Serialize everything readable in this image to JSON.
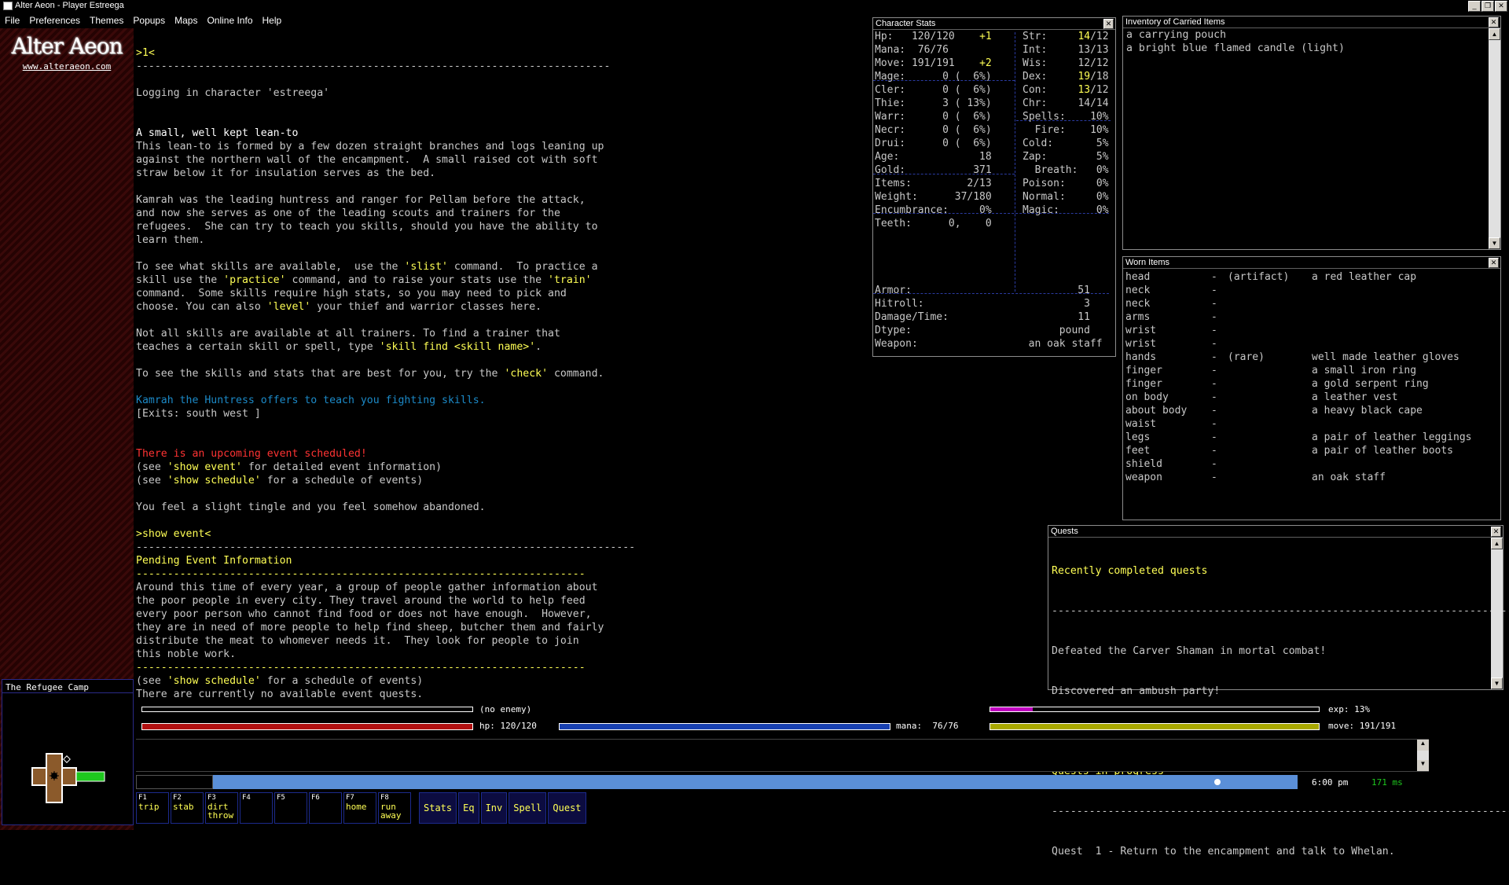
{
  "window": {
    "title": "Alter Aeon - Player Estreega",
    "buttons": [
      "_",
      "❐",
      "✕"
    ]
  },
  "menu": [
    "File",
    "Preferences",
    "Themes",
    "Popups",
    "Maps",
    "Online Info",
    "Help"
  ],
  "logo": {
    "name": "Alter Aeon",
    "url": "www.alteraeon.com"
  },
  "map": {
    "title": "The Refugee Camp"
  },
  "main_lines": [
    [
      {
        "t": ">1<",
        "c": "y"
      }
    ],
    [
      {
        "t": "----------------------------------------------------------------------------"
      }
    ],
    [
      {
        "t": ""
      }
    ],
    [
      {
        "t": "Logging in character 'estreega'"
      }
    ],
    [
      {
        "t": ""
      }
    ],
    [
      {
        "t": ""
      }
    ],
    [
      {
        "t": "A small, well kept lean-to",
        "c": "w"
      }
    ],
    [
      {
        "t": "This lean-to is formed by a few dozen straight branches and logs leaning up"
      }
    ],
    [
      {
        "t": "against the northern wall of the encampment.  A small raised cot with soft"
      }
    ],
    [
      {
        "t": "straw below it for insulation serves as the bed."
      }
    ],
    [
      {
        "t": ""
      }
    ],
    [
      {
        "t": "Kamrah was the leading huntress and ranger for Pellam before the attack,"
      }
    ],
    [
      {
        "t": "and now she serves as one of the leading scouts and trainers for the"
      }
    ],
    [
      {
        "t": "refugees.  She can try to teach you skills, should you have the ability to"
      }
    ],
    [
      {
        "t": "learn them."
      }
    ],
    [
      {
        "t": ""
      }
    ],
    [
      {
        "t": "To see what skills are available,  use the "
      },
      {
        "t": "'slist'",
        "c": "y"
      },
      {
        "t": " command.  To practice a"
      }
    ],
    [
      {
        "t": "skill use the "
      },
      {
        "t": "'practice'",
        "c": "y"
      },
      {
        "t": " command, and to raise your stats use the "
      },
      {
        "t": "'train'",
        "c": "y"
      }
    ],
    [
      {
        "t": "command.  Some skills require high stats, so you may need to pick and"
      }
    ],
    [
      {
        "t": "choose. You can also "
      },
      {
        "t": "'level'",
        "c": "y"
      },
      {
        "t": " your thief and warrior classes here."
      }
    ],
    [
      {
        "t": ""
      }
    ],
    [
      {
        "t": "Not all skills are available at all trainers. To find a trainer that"
      }
    ],
    [
      {
        "t": "teaches a certain skill or spell, type "
      },
      {
        "t": "'skill find <skill name>'",
        "c": "y"
      },
      {
        "t": "."
      }
    ],
    [
      {
        "t": ""
      }
    ],
    [
      {
        "t": "To see the skills and stats that are best for you, try the "
      },
      {
        "t": "'check'",
        "c": "y"
      },
      {
        "t": " command."
      }
    ],
    [
      {
        "t": ""
      }
    ],
    [
      {
        "t": "Kamrah the Huntress offers to teach you fighting skills.",
        "c": "c"
      }
    ],
    [
      {
        "t": "[Exits: south west ]"
      }
    ],
    [
      {
        "t": ""
      }
    ],
    [
      {
        "t": ""
      }
    ],
    [
      {
        "t": "There is an upcoming event scheduled!",
        "c": "r"
      }
    ],
    [
      {
        "t": "(see "
      },
      {
        "t": "'show event'",
        "c": "y"
      },
      {
        "t": " for detailed event information)"
      }
    ],
    [
      {
        "t": "(see "
      },
      {
        "t": "'show schedule'",
        "c": "y"
      },
      {
        "t": " for a schedule of events)"
      }
    ],
    [
      {
        "t": ""
      }
    ],
    [
      {
        "t": "You feel a slight tingle and you feel somehow abandoned."
      }
    ],
    [
      {
        "t": ""
      }
    ],
    [
      {
        "t": ">show event<",
        "c": "y"
      }
    ],
    [
      {
        "t": "--------------------------------------------------------------------------------"
      }
    ],
    [
      {
        "t": "Pending Event Information",
        "c": "y"
      }
    ],
    [
      {
        "t": "------------------------------------------------------------------------",
        "c": "y"
      }
    ],
    [
      {
        "t": "Around this time of every year, a group of people gather information about"
      }
    ],
    [
      {
        "t": "the poor people in every city. They travel around the world to help feed"
      }
    ],
    [
      {
        "t": "every poor person who cannot find food or does not have enough.  However,"
      }
    ],
    [
      {
        "t": "they are in need of more people to help find sheep, butcher them and fairly"
      }
    ],
    [
      {
        "t": "distribute the meat to whomever needs it.  They look for people to join"
      }
    ],
    [
      {
        "t": "this noble work."
      }
    ],
    [
      {
        "t": "------------------------------------------------------------------------",
        "c": "y"
      }
    ],
    [
      {
        "t": "(see "
      },
      {
        "t": "'show schedule'",
        "c": "y"
      },
      {
        "t": " for a schedule of events)"
      }
    ],
    [
      {
        "t": "There are currently no available event quests."
      }
    ]
  ],
  "char_stats": {
    "title": "Character Stats",
    "left": [
      [
        {
          "t": "Hp:   120/120    "
        },
        {
          "t": "+1",
          "c": "y"
        }
      ],
      [
        {
          "t": "Mana:  76/76"
        }
      ],
      [
        {
          "t": "Move: 191/191    "
        },
        {
          "t": "+2",
          "c": "y"
        }
      ],
      [
        {
          "t": ""
        }
      ],
      [
        {
          "t": "Mage:      0 (  6%)"
        }
      ],
      [
        {
          "t": "Cler:      0 (  6%)"
        }
      ],
      [
        {
          "t": "Thie:      3 ( 13%)"
        }
      ],
      [
        {
          "t": "Warr:      0 (  6%)"
        }
      ],
      [
        {
          "t": "Necr:      0 (  6%)"
        }
      ],
      [
        {
          "t": "Drui:      0 (  6%)"
        }
      ],
      [
        {
          "t": ""
        }
      ],
      [
        {
          "t": "Age:             18"
        }
      ],
      [
        {
          "t": "Gold:           371"
        }
      ],
      [
        {
          "t": ""
        }
      ],
      [
        {
          "t": "Items:         2/13"
        }
      ],
      [
        {
          "t": "Weight:      37/180"
        }
      ],
      [
        {
          "t": "Encumbrance:     0%"
        }
      ],
      [
        {
          "t": "Teeth:      0,    0"
        }
      ]
    ],
    "right": [
      [
        {
          "t": "Str:     "
        },
        {
          "t": "14",
          "c": "y"
        },
        {
          "t": "/12"
        }
      ],
      [
        {
          "t": "Int:     13/13"
        }
      ],
      [
        {
          "t": "Wis:     12/12"
        }
      ],
      [
        {
          "t": "Dex:     "
        },
        {
          "t": "19",
          "c": "y"
        },
        {
          "t": "/18"
        }
      ],
      [
        {
          "t": "Con:     "
        },
        {
          "t": "13",
          "c": "y"
        },
        {
          "t": "/12"
        }
      ],
      [
        {
          "t": "Chr:     14/14"
        }
      ],
      [
        {
          "t": ""
        }
      ],
      [
        {
          "t": ""
        }
      ],
      [
        {
          "t": ""
        }
      ],
      [
        {
          "t": "Spells:    10%"
        }
      ],
      [
        {
          "t": "  Fire:    10%"
        }
      ],
      [
        {
          "t": "Cold:       5%"
        }
      ],
      [
        {
          "t": "Zap:        5%"
        }
      ],
      [
        {
          "t": "  Breath:   0%"
        }
      ],
      [
        {
          "t": "Poison:     0%"
        }
      ],
      [
        {
          "t": "Normal:     0%"
        }
      ],
      [
        {
          "t": "Magic:      0%"
        }
      ],
      [
        {
          "t": ""
        }
      ]
    ],
    "bottom": [
      [
        {
          "t": "Armor:                           51"
        }
      ],
      [
        {
          "t": "Hitroll:                          3"
        }
      ],
      [
        {
          "t": "Damage/Time:                     11"
        }
      ],
      [
        {
          "t": "Dtype:                        pound"
        }
      ],
      [
        {
          "t": "Weapon:                  an oak staff"
        }
      ]
    ]
  },
  "inventory": {
    "title": "Inventory of Carried Items",
    "items": [
      "a carrying pouch",
      "a bright blue flamed candle (light)"
    ]
  },
  "worn": {
    "title": "Worn Items",
    "rows": [
      {
        "slot": "head",
        "empty": false,
        "tag": "(artifact)",
        "item": "a red leather cap"
      },
      {
        "slot": "neck",
        "empty": true,
        "tag": "",
        "item": ""
      },
      {
        "slot": "neck",
        "empty": true,
        "tag": "",
        "item": ""
      },
      {
        "slot": "arms",
        "empty": true,
        "tag": "",
        "item": ""
      },
      {
        "slot": "wrist",
        "empty": true,
        "tag": "",
        "item": ""
      },
      {
        "slot": "wrist",
        "empty": true,
        "tag": "",
        "item": ""
      },
      {
        "slot": "hands",
        "empty": false,
        "tag": "(rare)",
        "item": "well made leather gloves"
      },
      {
        "slot": "finger",
        "empty": false,
        "tag": "",
        "item": "a small iron ring"
      },
      {
        "slot": "finger",
        "empty": false,
        "tag": "",
        "item": "a gold serpent ring"
      },
      {
        "slot": "on body",
        "empty": false,
        "tag": "",
        "item": "a leather vest"
      },
      {
        "slot": "about body",
        "empty": false,
        "tag": "",
        "item": "a heavy black cape"
      },
      {
        "slot": "waist",
        "empty": true,
        "tag": "",
        "item": ""
      },
      {
        "slot": "legs",
        "empty": false,
        "tag": "",
        "item": "a pair of leather leggings"
      },
      {
        "slot": "feet",
        "empty": false,
        "tag": "",
        "item": "a pair of leather boots"
      },
      {
        "slot": "shield",
        "empty": false,
        "tag": "",
        "item": ""
      },
      {
        "slot": "weapon",
        "empty": false,
        "tag": "",
        "item": "an oak staff"
      }
    ],
    "dash": "-"
  },
  "quests": {
    "title": "Quests",
    "completed_header": "Recently completed quests",
    "completed": [
      "Defeated the Carver Shaman in mortal combat!",
      "Discovered an ambush party!"
    ],
    "progress_header": "Quests in progress",
    "in_progress": [
      "Quest  1 - Return to the encampment and talk to Whelan."
    ],
    "divider": "------------------------------------------------------------------------------------"
  },
  "bars": {
    "enemy": "(no enemy)",
    "exp": "exp: 13%",
    "exp_fraction": 0.13,
    "hp": "hp: 120/120",
    "mana": "mana:  76/76",
    "move": "move: 191/191",
    "hp_color": "#b01010",
    "mana_color": "#1840b0",
    "move_color": "#a8a800",
    "exp_color": "#c000c0"
  },
  "status": {
    "time": "6:00 pm",
    "ping": "171 ms"
  },
  "fkeys": [
    {
      "key": "F1",
      "label": "trip"
    },
    {
      "key": "F2",
      "label": "stab"
    },
    {
      "key": "F3",
      "label": "dirt\nthrow"
    },
    {
      "key": "F4",
      "label": ""
    },
    {
      "key": "F5",
      "label": ""
    },
    {
      "key": "F6",
      "label": ""
    },
    {
      "key": "F7",
      "label": "home"
    },
    {
      "key": "F8",
      "label": "run\naway"
    }
  ],
  "panel_buttons": [
    "Stats",
    "Eq",
    "Inv",
    "Spell",
    "Quest"
  ]
}
